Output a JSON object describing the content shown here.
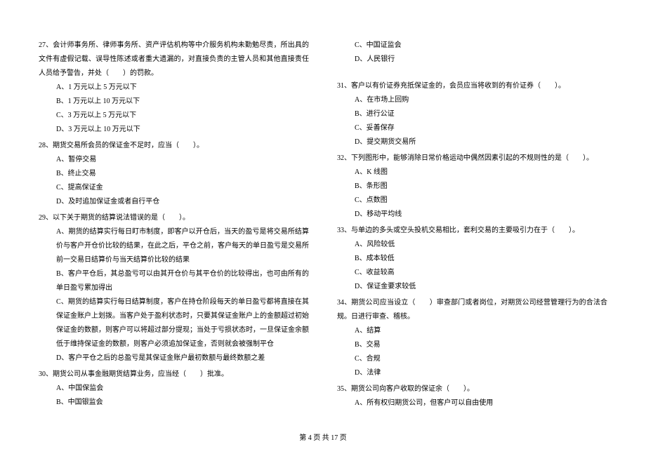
{
  "left": {
    "q27": {
      "stem": "27、会计师事务所、律师事务所、资产评估机构等中介服务机构未勤勉尽责，所出具的文件有虚假记载、误导性陈述或者重大遗漏的，对直接负责的主管人员和其他直接责任人员给予警告，并处（　　）的罚款。",
      "a": "A、1 万元以上 5 万元以下",
      "b": "B、1 万元以上 10 万元以下",
      "c": "C、3 万元以上 5 万元以下",
      "d": "D、3 万元以上 10 万元以下"
    },
    "q28": {
      "stem": "28、期货交易所会员的保证金不足时，应当（　　）。",
      "a": "A、暂停交易",
      "b": "B、终止交易",
      "c": "C、提高保证金",
      "d": "D、及时追加保证金或者自行平仓"
    },
    "q29": {
      "stem": "29、以下关于期货的结算说法错误的是（　　）。",
      "a": "A、期货的结算实行每日盯市制度，即客户以开仓后，当天的盈亏是将交易所结算价与客户开仓价比较的结果，在此之后，平仓之前，客户每天的单日盈亏是交易所前一交易日结算价与当天结算价比较的结果",
      "b": "B、客户平仓后，其总盈亏可以由其开仓价与其平仓价的比较得出，也可由所有的单日盈亏累加得出",
      "c": "C、期货的结算实行每日结算制度，客户在持仓阶段每天的单日盈亏都将直接在其保证金账户上划拨。当客户处于盈利状态时，只要其保证金账户上的金额超过初始保证金的数额，则客户可以将超过部分提现；当处于亏损状态时，一旦保证金余额低于维持保证金的数额，则客户必须追加保证金，否则就会被强制平仓",
      "d": "D、客户平仓之后的总盈亏是其保证金账户最初数额与最终数额之差"
    },
    "q30": {
      "stem": "30、期货公司从事金融期货结算业务，应当经（　　）批准。",
      "a": "A、中国保监会",
      "b": "B、中国银监会"
    }
  },
  "right": {
    "q30c": "C、中国证监会",
    "q30d": "D、人民银行",
    "q31": {
      "stem": "31、客户以有价证券充抵保证金的，会员应当将收到的有价证券（　　）。",
      "a": "A、在市场上回购",
      "b": "B、进行公证",
      "c": "C、妥善保存",
      "d": "D、提交期货交易所"
    },
    "q32": {
      "stem": "32、下列图形中，能够消除日常价格运动中偶然因素引起的不规则性的是（　　）。",
      "a": "A、K 线图",
      "b": "B、条形图",
      "c": "C、点数图",
      "d": "D、移动平均线"
    },
    "q33": {
      "stem": "33、与单边的多头或空头投机交易相比，套利交易的主要吸引力在于（　　）。",
      "a": "A、风险较低",
      "b": "B、成本较低",
      "c": "C、收益较高",
      "d": "D、保证金要求较低"
    },
    "q34": {
      "stem": "34、期货公司应当设立（　　）审查部门或者岗位，对期货公司经营管理行为的合法合规。日进行审查、稽核。",
      "a": "A、结算",
      "b": "B、交易",
      "c": "C、合规",
      "d": "D、法律"
    },
    "q35": {
      "stem": "35、期货公司向客户收取的保证余（　　）。",
      "a": "A、所有权归期货公司，但客户可以自由使用"
    }
  },
  "footer": "第 4 页 共 17 页"
}
